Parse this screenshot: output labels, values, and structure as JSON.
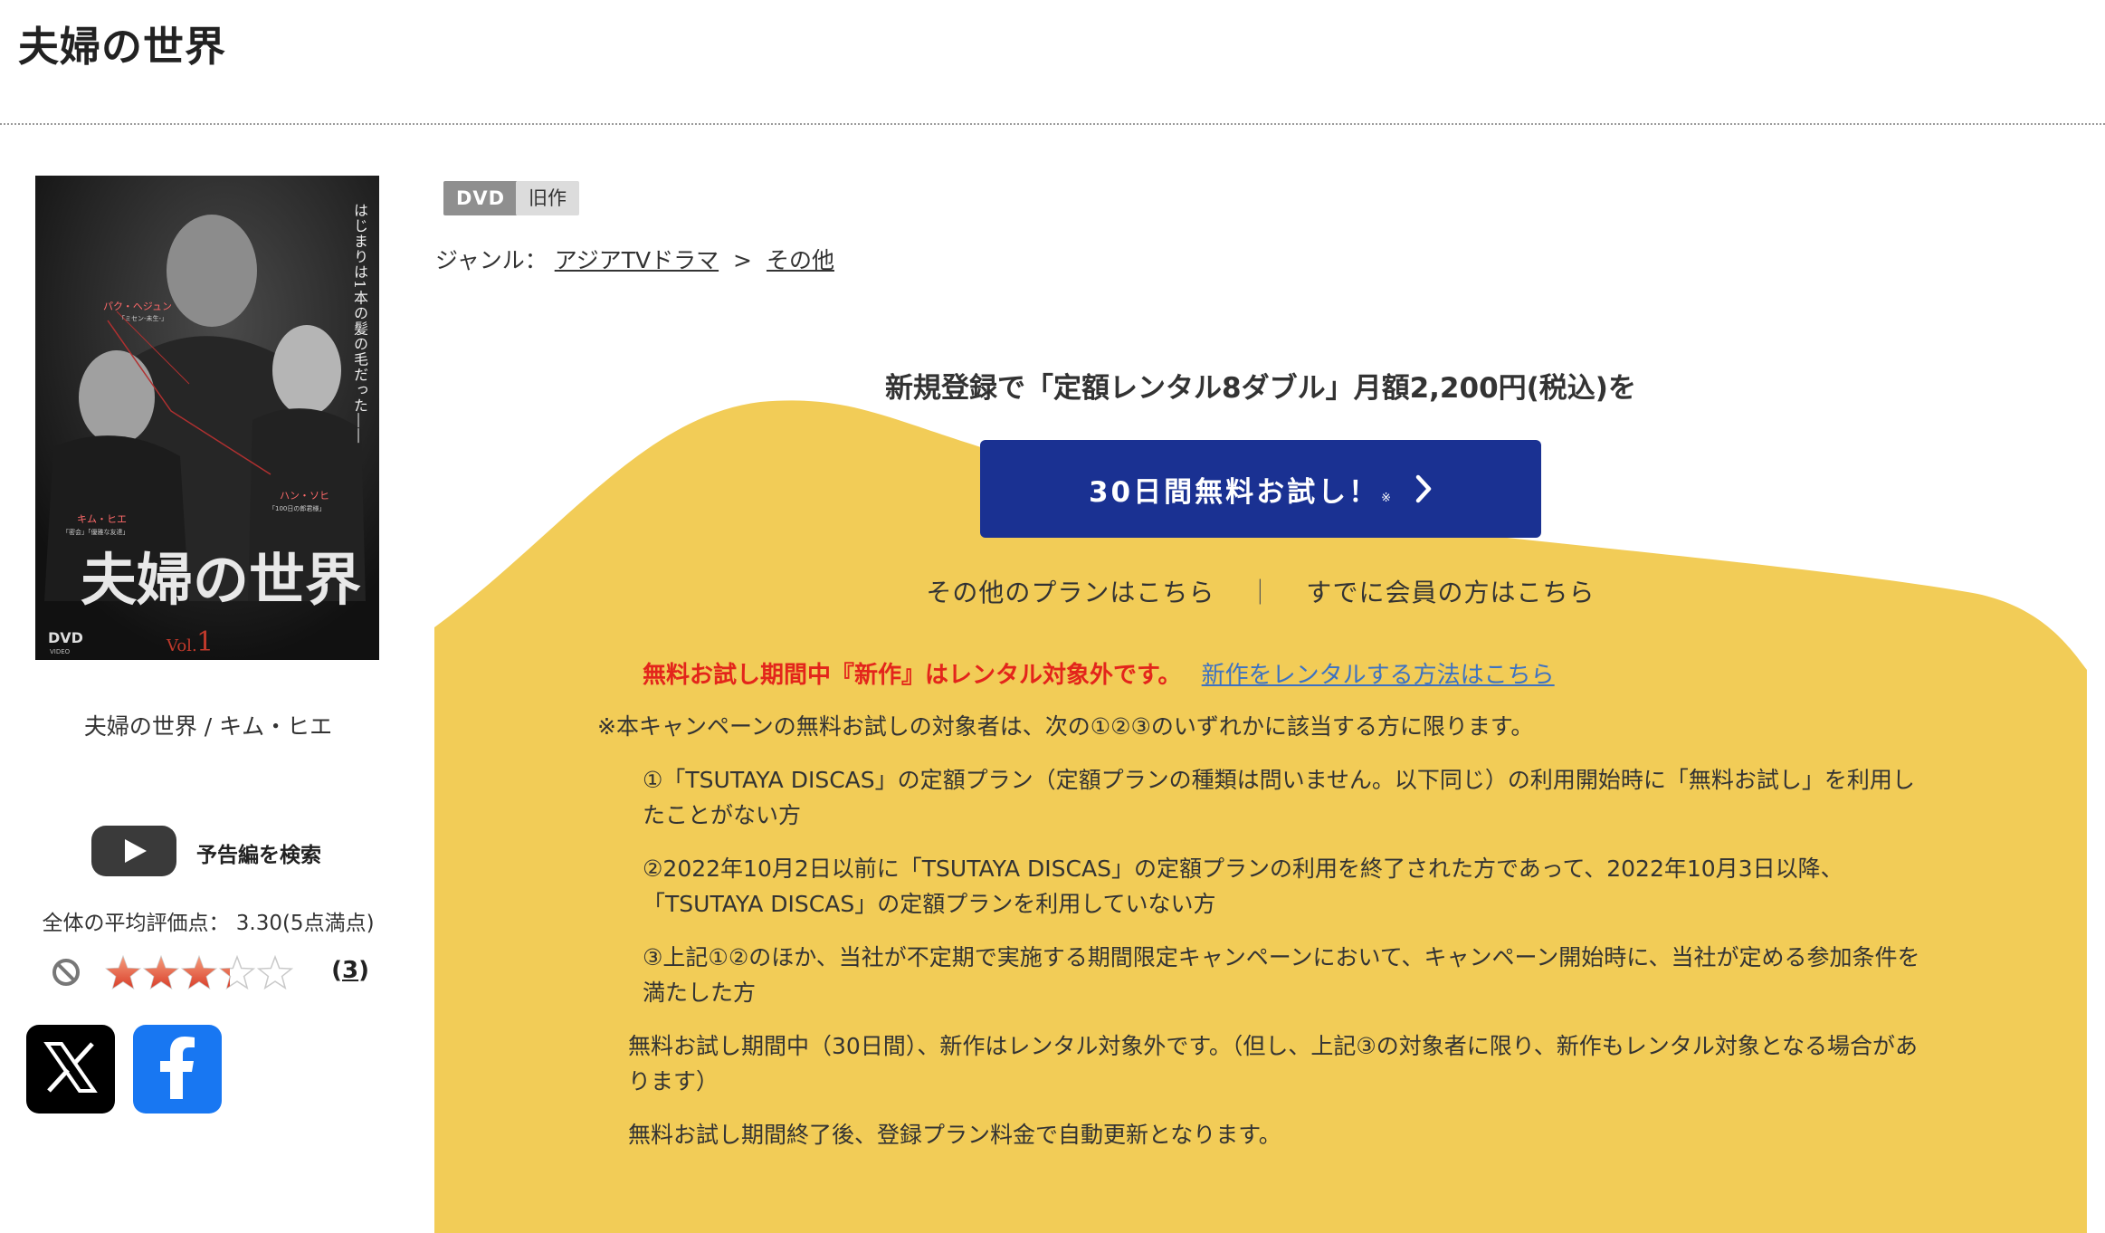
{
  "page": {
    "title": "夫婦の世界"
  },
  "cover": {
    "vertical_text": "はじまりは1本の髪の毛だった――",
    "title_text": "夫婦の世界",
    "vol_text": "Vol.",
    "vol_number": "1",
    "cast": [
      {
        "name": "パク・ヘジュン",
        "role": "「ミセン-未生-」"
      },
      {
        "name": "キム・ヒエ",
        "role": "「密会」「優雅な友達」"
      },
      {
        "name": "ハン・ソヒ",
        "role": "「100日の郎君様」"
      }
    ],
    "dvd_logo": "DVD",
    "dvd_logo_sub": "VIDEO"
  },
  "product": {
    "caption": "夫婦の世界 / キム・ヒエ"
  },
  "trailer": {
    "label": "予告編を検索"
  },
  "rating": {
    "text": "全体の平均評価点： 3.30(5点満点)",
    "value": 3.3,
    "max": 5,
    "review_count_open": "(",
    "review_count": "3",
    "review_count_close": ")"
  },
  "tags": {
    "format": "DVD",
    "status": "旧作"
  },
  "genre": {
    "label": "ジャンル：",
    "items": [
      "アジアTVドラマ",
      "その他"
    ],
    "separator": ">"
  },
  "promo": {
    "headline": "新規登録で「定額レンタル8ダブル」月額2,200円(税込)を",
    "cta_label": "30日間無料お試し！",
    "cta_note": "※",
    "other_plans": "その他のプランはこちら",
    "divider": "｜",
    "member_link": "すでに会員の方はこちら",
    "warning": "無料お試し期間中『新作』はレンタル対象外です。",
    "warning_link": "新作をレンタルする方法はこちら",
    "note_main": "※本キャンペーンの無料お試しの対象者は、次の①②③のいずれかに該当する方に限ります。",
    "conditions": [
      "①「TSUTAYA DISCAS」の定額プラン（定額プランの種類は問いません。以下同じ）の利用開始時に「無料お試し」を利用したことがない方",
      "②2022年10月2日以前に「TSUTAYA DISCAS」の定額プランの利用を終了された方であって、2022年10月3日以降、「TSUTAYA DISCAS」の定額プランを利用していない方",
      "③上記①②のほか、当社が不定期で実施する期間限定キャンペーンにおいて、キャンペーン開始時に、当社が定める参加条件を満たした方"
    ],
    "note_period": "無料お試し期間中（30日間）、新作はレンタル対象外です。（但し、上記③の対象者に限り、新作もレンタル対象となる場合があります）",
    "note_renew": "無料お試し期間終了後、登録プラン料金で自動更新となります。"
  },
  "colors": {
    "cta_bg": "#1a3192",
    "promo_bg": "#f2cc57",
    "warning_red": "#e3251b",
    "link_blue": "#3d72c2",
    "facebook": "#1877f2"
  }
}
